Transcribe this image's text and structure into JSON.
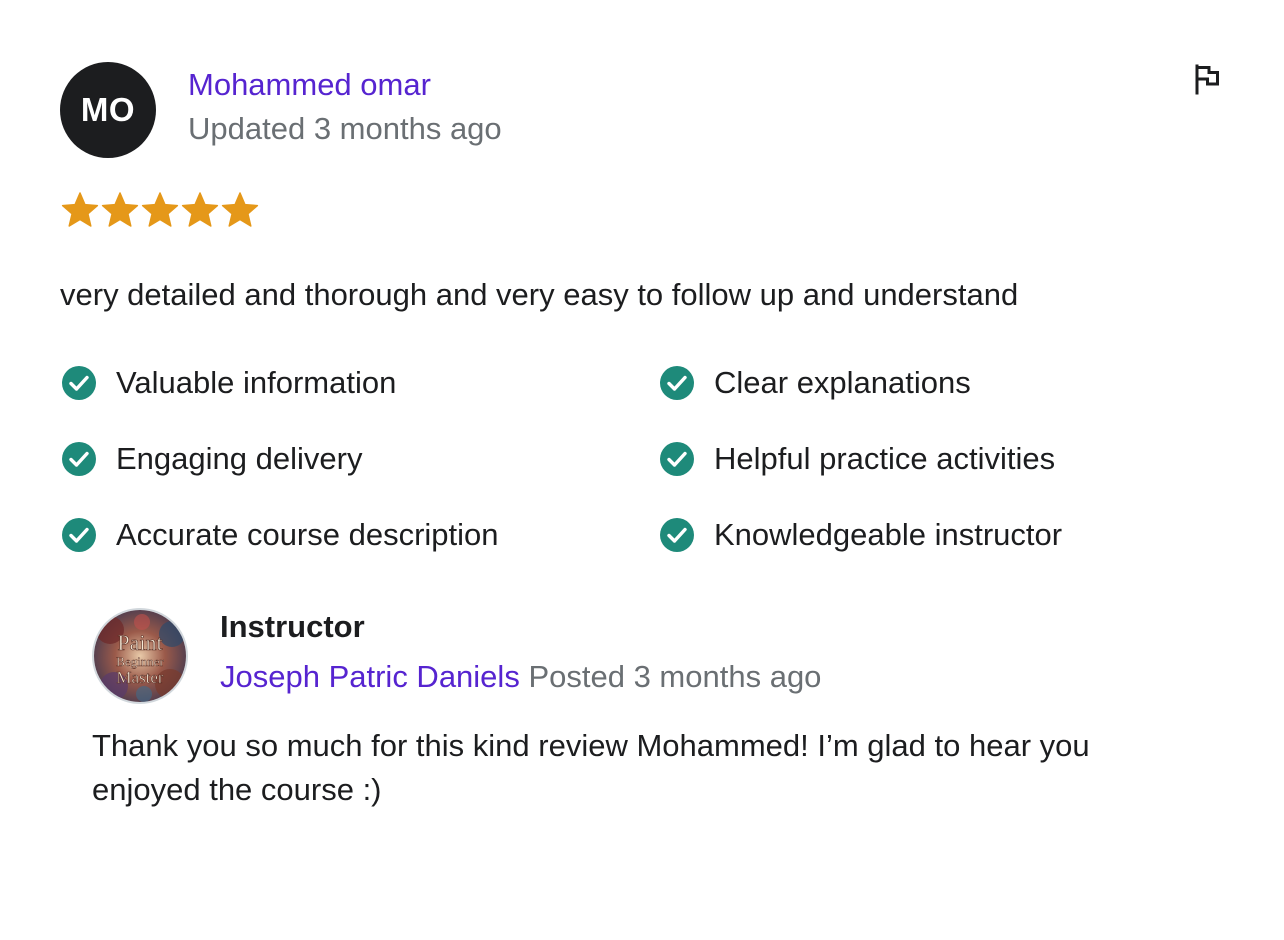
{
  "review": {
    "avatar_initials": "MO",
    "reviewer_name": "Mohammed omar",
    "updated": "Updated 3 months ago",
    "rating": 5,
    "rating_max": 5,
    "text": "very detailed and thorough and very easy to follow up and understand",
    "flag_icon": "flag-icon",
    "feedback": [
      {
        "label": "Valuable information",
        "checked": true
      },
      {
        "label": "Clear explanations",
        "checked": true
      },
      {
        "label": "Engaging delivery",
        "checked": true
      },
      {
        "label": "Helpful practice activities",
        "checked": true
      },
      {
        "label": "Accurate course description",
        "checked": true
      },
      {
        "label": "Knowledgeable instructor",
        "checked": true
      }
    ]
  },
  "instructor_response": {
    "role": "Instructor",
    "name": "Joseph Patric Daniels",
    "posted": "Posted 3 months ago",
    "avatar_text": [
      "Paint",
      "Beginner",
      "Master"
    ],
    "text": "Thank you so much for this kind review Mohammed! I’m glad to hear you enjoyed the course :)"
  },
  "colors": {
    "accent": "#5624d0",
    "muted": "#6a6f73",
    "star": "#e59819",
    "check": "#1e8a7a",
    "text": "#1c1d1f"
  }
}
